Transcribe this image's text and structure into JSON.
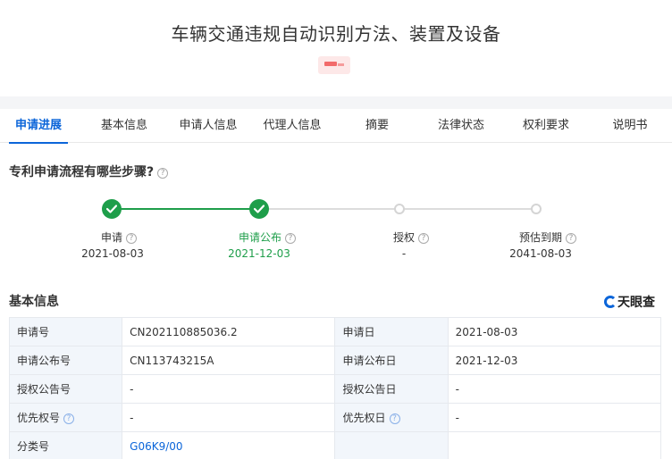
{
  "header": {
    "title": "车辆交通违规自动识别方法、装置及设备"
  },
  "tabs": [
    {
      "label": "申请进展",
      "active": true
    },
    {
      "label": "基本信息"
    },
    {
      "label": "申请人信息"
    },
    {
      "label": "代理人信息"
    },
    {
      "label": "摘要"
    },
    {
      "label": "法律状态"
    },
    {
      "label": "权利要求"
    },
    {
      "label": "说明书"
    }
  ],
  "progress": {
    "question": "专利申请流程有哪些步骤?",
    "steps": [
      {
        "label": "申请",
        "date": "2021-08-03",
        "status": "done"
      },
      {
        "label": "申请公布",
        "date": "2021-12-03",
        "status": "done"
      },
      {
        "label": "授权",
        "date": "-",
        "status": "pending"
      },
      {
        "label": "预估到期",
        "date": "2041-08-03",
        "status": "pending"
      }
    ]
  },
  "basic": {
    "title": "基本信息",
    "brand": "天眼查",
    "rows": [
      {
        "k1": "申请号",
        "v1": "CN202110885036.2",
        "k2": "申请日",
        "v2": "2021-08-03"
      },
      {
        "k1": "申请公布号",
        "v1": "CN113743215A",
        "k2": "申请公布日",
        "v2": "2021-12-03"
      },
      {
        "k1": "授权公告号",
        "v1": "-",
        "k2": "授权公告日",
        "v2": "-"
      },
      {
        "k1": "优先权号",
        "v1": "-",
        "k2": "优先权日",
        "v2": "-"
      },
      {
        "k1": "分类号",
        "v1": "G06K9/00",
        "k2": "",
        "v2": ""
      }
    ]
  },
  "colors": {
    "accent": "#0b65d9",
    "done": "#1e9e4a",
    "pending": "#d4d4d4"
  }
}
